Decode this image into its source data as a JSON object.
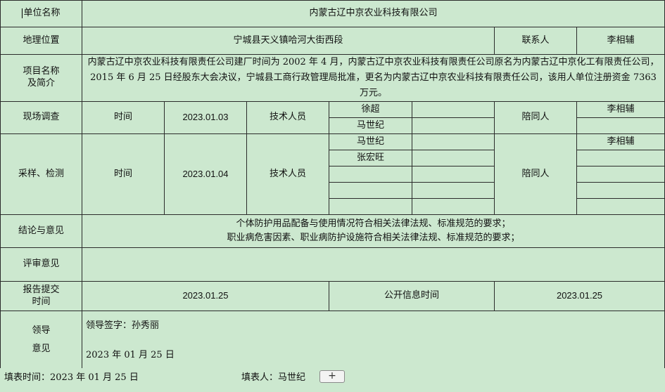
{
  "rows": {
    "unit": {
      "label": "单位名称",
      "value": "内蒙古辽中京农业科技有限公司"
    },
    "location": {
      "label": "地理位置",
      "value": "宁城县天义镇哈河大街西段",
      "contact_label": "联系人",
      "contact_value": "李相辅"
    },
    "project": {
      "label_line1": "项目名称",
      "label_line2": "及简介",
      "description": "内蒙古辽中京农业科技有限责任公司建厂时间为 2002 年 4 月，内蒙古辽中京农业科技有限责任公司原名为内蒙古辽中京化工有限责任公司，2015 年 6 月 25 日经股东大会决议，宁城县工商行政管理局批准，更名为内蒙古辽中京农业科技有限责任公司，该用人单位注册资金 7363 万元。"
    },
    "site_survey": {
      "label": "现场调查",
      "time_label": "时间",
      "time_value": "2023.01.03",
      "tech_label": "技术人员",
      "tech_people": [
        "徐超",
        "马世纪"
      ],
      "accompany_label": "陪同人",
      "accompany_people": [
        "李相辅"
      ]
    },
    "sampling": {
      "label": "采样、检测",
      "time_label": "时间",
      "time_value": "2023.01.04",
      "tech_label": "技术人员",
      "tech_people": [
        "马世纪",
        "张宏旺"
      ],
      "accompany_label": "陪同人",
      "accompany_people": [
        "李相辅"
      ]
    },
    "conclusion": {
      "label": "结论与意见",
      "line1": "个体防护用品配备与使用情况符合相关法律法规、标准规范的要求；",
      "line2": "职业病危害因素、职业病防护设施符合相关法律法规、标准规范的要求；"
    },
    "review": {
      "label": "评审意见",
      "value": ""
    },
    "report": {
      "label_line1": "报告提交",
      "label_line2": "时间",
      "value": "2023.01.25",
      "disclosure_label": "公开信息时间",
      "disclosure_value": "2023.01.25"
    },
    "leader": {
      "label_line1": "领导",
      "label_line2": "意见",
      "sign": "领导签字：孙秀丽",
      "date": "2023 年  01 月 25 日"
    }
  },
  "footer": {
    "fill_date": "填表时间：2023 年  01 月 25 日",
    "filler": "填表人：马世纪",
    "add_button": "+"
  }
}
